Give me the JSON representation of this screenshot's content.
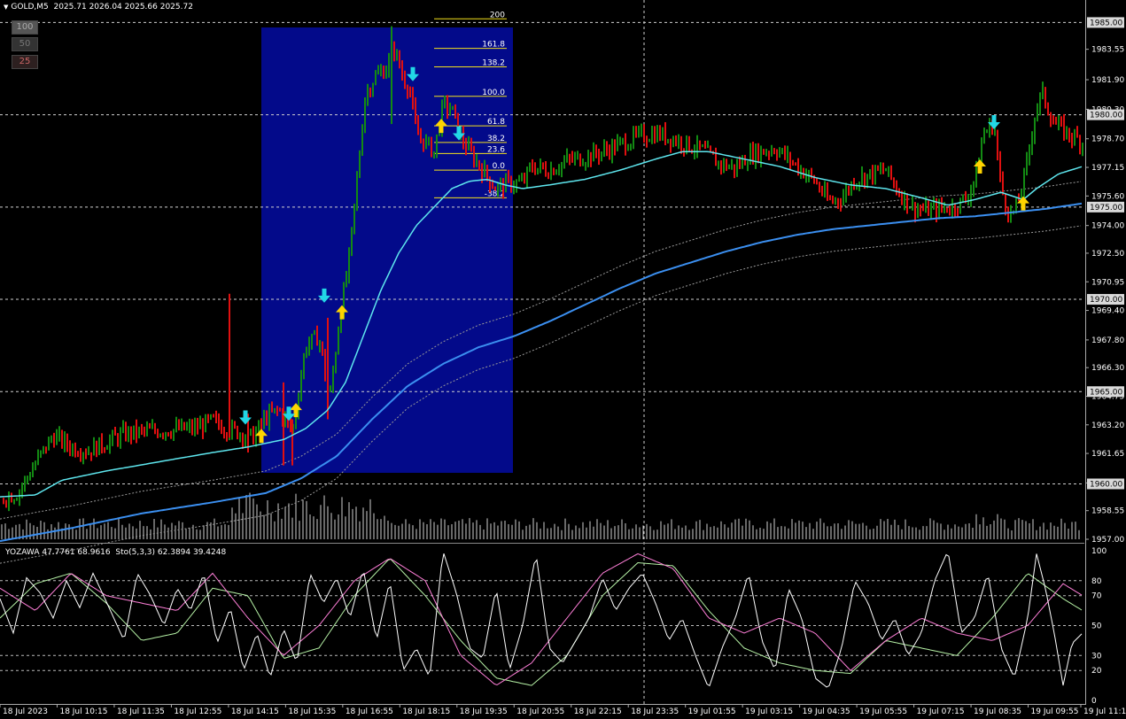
{
  "window": {
    "symbol_title": "GOLD,M5",
    "ohlc": "2025.71 2026.04 2025.66 2025.72"
  },
  "buttons": [
    {
      "label": "100"
    },
    {
      "label": "50"
    },
    {
      "label": "25"
    }
  ],
  "oscillator": {
    "title": "YOZAWA 47.7761 68.9616",
    "stoch_label": "Sto(5,3,3) 62.3894 39.4248"
  },
  "colors": {
    "background": "#000000",
    "up_bar": "#138a13",
    "down_bar": "#e01010",
    "fast_ma": "#5ee6ee",
    "slow_ma": "#3b8ff0",
    "fib_box": "#030a8a",
    "fib_line": "#f4e11c",
    "arrow_up": "#ffd400",
    "arrow_down": "#22d7e6",
    "stoch_main": "#ffffff",
    "stoch_signal": "#ff7fd8",
    "yozawa": "#b6f2a6"
  },
  "icons": {
    "buy": "arrow-up-icon",
    "sell": "arrow-down-icon"
  },
  "chart_data": {
    "type": "bar",
    "price_axis": {
      "ticks": [
        "1983.55",
        "1981.90",
        "1980.30",
        "1978.70",
        "1977.15",
        "1975.60",
        "1974.00",
        "1972.50",
        "1970.95",
        "1969.40",
        "1967.80",
        "1966.30",
        "1964.75",
        "1963.20",
        "1961.65",
        "1960.05",
        "1958.55",
        "1957.00"
      ],
      "ylim": [
        1957.0,
        1985.5
      ],
      "level_lines": [
        1985.0,
        1980.0,
        1975.0,
        1970.0,
        1965.0,
        1960.0
      ],
      "level_labels": [
        "1985.00",
        "1980.00",
        "1975.00",
        "1970.00",
        "1965.00",
        "1960.00"
      ]
    },
    "time_axis": {
      "labels": [
        "18 Jul 2023",
        "18 Jul 10:15",
        "18 Jul 11:35",
        "18 Jul 12:55",
        "18 Jul 14:15",
        "18 Jul 15:35",
        "18 Jul 16:55",
        "18 Jul 18:15",
        "18 Jul 19:35",
        "18 Jul 20:55",
        "18 Jul 22:15",
        "18 Jul 23:35",
        "19 Jul 01:55",
        "19 Jul 03:15",
        "19 Jul 04:35",
        "19 Jul 05:55",
        "19 Jul 07:15",
        "19 Jul 08:35",
        "19 Jul 09:55",
        "19 Jul 11:15"
      ]
    },
    "fibonacci": {
      "levels": [
        "200",
        "161.8",
        "138.2",
        "100.0",
        "61.8",
        "38.2",
        "23.6",
        "0.0",
        "-38.2"
      ],
      "prices": [
        1985.2,
        1983.6,
        1982.6,
        1981.0,
        1979.4,
        1978.5,
        1977.9,
        1977.0,
        1975.5
      ]
    },
    "oscillator_axis": {
      "ticks": [
        "100",
        "80",
        "70",
        "50",
        "30",
        "20",
        "0"
      ],
      "ylim": [
        0,
        100
      ]
    },
    "price_anchors": [
      [
        0,
        1959.2
      ],
      [
        20,
        1959.5
      ],
      [
        30,
        1960.3
      ],
      [
        45,
        1961.5
      ],
      [
        60,
        1962.6
      ],
      [
        80,
        1962.0
      ],
      [
        100,
        1961.8
      ],
      [
        140,
        1962.7
      ],
      [
        180,
        1962.9
      ],
      [
        220,
        1963.0
      ],
      [
        240,
        1963.4
      ],
      [
        255,
        1963.0
      ],
      [
        270,
        1962.8
      ],
      [
        285,
        1962.5
      ],
      [
        300,
        1963.6
      ],
      [
        315,
        1964.0
      ],
      [
        330,
        1962.8
      ],
      [
        345,
        1967.5
      ],
      [
        360,
        1968.0
      ],
      [
        372,
        1964.5
      ],
      [
        382,
        1968.5
      ],
      [
        395,
        1972.5
      ],
      [
        405,
        1977.5
      ],
      [
        412,
        1981.0
      ],
      [
        422,
        1982.0
      ],
      [
        435,
        1982.5
      ],
      [
        445,
        1983.6
      ],
      [
        455,
        1982.0
      ],
      [
        462,
        1981.5
      ],
      [
        470,
        1979.0
      ],
      [
        480,
        1978.5
      ],
      [
        490,
        1978.0
      ],
      [
        500,
        1980.5
      ],
      [
        510,
        1980.3
      ],
      [
        520,
        1978.8
      ],
      [
        530,
        1978.0
      ],
      [
        545,
        1977.0
      ],
      [
        560,
        1976.0
      ],
      [
        575,
        1976.3
      ],
      [
        590,
        1976.3
      ],
      [
        600,
        1977.2
      ],
      [
        620,
        1977.0
      ],
      [
        640,
        1977.5
      ],
      [
        660,
        1977.7
      ],
      [
        680,
        1978.0
      ],
      [
        700,
        1978.4
      ],
      [
        720,
        1978.8
      ],
      [
        740,
        1979.0
      ],
      [
        760,
        1978.7
      ],
      [
        780,
        1978.3
      ],
      [
        795,
        1978.0
      ],
      [
        810,
        1977.4
      ],
      [
        830,
        1977.1
      ],
      [
        845,
        1977.8
      ],
      [
        860,
        1978.0
      ],
      [
        875,
        1978.2
      ],
      [
        890,
        1977.6
      ],
      [
        905,
        1977.0
      ],
      [
        920,
        1976.4
      ],
      [
        935,
        1975.3
      ],
      [
        950,
        1975.5
      ],
      [
        965,
        1976.5
      ],
      [
        985,
        1976.8
      ],
      [
        1000,
        1977.0
      ],
      [
        1015,
        1975.8
      ],
      [
        1030,
        1975.0
      ],
      [
        1045,
        1974.8
      ],
      [
        1060,
        1974.9
      ],
      [
        1075,
        1975.0
      ],
      [
        1090,
        1975.4
      ],
      [
        1100,
        1976.5
      ],
      [
        1110,
        1979.0
      ],
      [
        1122,
        1979.5
      ],
      [
        1130,
        1976.0
      ],
      [
        1140,
        1974.5
      ],
      [
        1148,
        1975.0
      ],
      [
        1158,
        1977.0
      ],
      [
        1168,
        1980.0
      ],
      [
        1176,
        1981.2
      ],
      [
        1190,
        1979.5
      ],
      [
        1205,
        1979.0
      ],
      [
        1222,
        1978.5
      ]
    ],
    "fast_ma_anchors": [
      [
        0,
        1959.3
      ],
      [
        40,
        1959.4
      ],
      [
        70,
        1960.2
      ],
      [
        120,
        1960.7
      ],
      [
        180,
        1961.2
      ],
      [
        240,
        1961.7
      ],
      [
        280,
        1962.0
      ],
      [
        320,
        1962.4
      ],
      [
        345,
        1963.0
      ],
      [
        370,
        1964.0
      ],
      [
        390,
        1965.5
      ],
      [
        410,
        1968.0
      ],
      [
        430,
        1970.5
      ],
      [
        450,
        1972.5
      ],
      [
        470,
        1974.0
      ],
      [
        490,
        1975.0
      ],
      [
        510,
        1976.0
      ],
      [
        530,
        1976.4
      ],
      [
        550,
        1976.5
      ],
      [
        570,
        1976.2
      ],
      [
        590,
        1976.0
      ],
      [
        620,
        1976.2
      ],
      [
        660,
        1976.5
      ],
      [
        700,
        1977.0
      ],
      [
        740,
        1977.6
      ],
      [
        770,
        1978.0
      ],
      [
        800,
        1978.0
      ],
      [
        840,
        1977.6
      ],
      [
        880,
        1977.2
      ],
      [
        920,
        1976.6
      ],
      [
        960,
        1976.2
      ],
      [
        1000,
        1976.0
      ],
      [
        1040,
        1975.5
      ],
      [
        1070,
        1975.1
      ],
      [
        1100,
        1975.4
      ],
      [
        1130,
        1975.8
      ],
      [
        1155,
        1975.4
      ],
      [
        1170,
        1976.0
      ],
      [
        1195,
        1976.8
      ],
      [
        1222,
        1977.2
      ]
    ],
    "slow_ma_anchors": [
      [
        0,
        1956.9
      ],
      [
        80,
        1957.6
      ],
      [
        160,
        1958.4
      ],
      [
        240,
        1959.0
      ],
      [
        300,
        1959.5
      ],
      [
        340,
        1960.3
      ],
      [
        380,
        1961.5
      ],
      [
        420,
        1963.5
      ],
      [
        460,
        1965.3
      ],
      [
        500,
        1966.5
      ],
      [
        540,
        1967.4
      ],
      [
        580,
        1968.0
      ],
      [
        620,
        1968.8
      ],
      [
        660,
        1969.7
      ],
      [
        700,
        1970.6
      ],
      [
        740,
        1971.4
      ],
      [
        780,
        1972.0
      ],
      [
        820,
        1972.6
      ],
      [
        860,
        1973.1
      ],
      [
        900,
        1973.5
      ],
      [
        940,
        1973.8
      ],
      [
        980,
        1974.0
      ],
      [
        1020,
        1974.2
      ],
      [
        1060,
        1974.4
      ],
      [
        1100,
        1974.5
      ],
      [
        1140,
        1974.7
      ],
      [
        1180,
        1974.9
      ],
      [
        1222,
        1975.2
      ]
    ],
    "arrows_up": [
      [
        295,
        1962.6
      ],
      [
        334,
        1964.0
      ],
      [
        386,
        1969.3
      ],
      [
        498,
        1979.4
      ],
      [
        1106,
        1977.2
      ],
      [
        1155,
        1975.2
      ]
    ],
    "arrows_down": [
      [
        277,
        1963.6
      ],
      [
        326,
        1963.8
      ],
      [
        366,
        1970.2
      ],
      [
        466,
        1982.2
      ],
      [
        518,
        1979.0
      ],
      [
        1122,
        1979.6
      ]
    ],
    "stoch_main_anchors": [
      [
        0,
        68
      ],
      [
        15,
        45
      ],
      [
        30,
        82
      ],
      [
        45,
        72
      ],
      [
        60,
        55
      ],
      [
        75,
        80
      ],
      [
        90,
        62
      ],
      [
        105,
        85
      ],
      [
        120,
        66
      ],
      [
        140,
        40
      ],
      [
        155,
        85
      ],
      [
        170,
        70
      ],
      [
        185,
        50
      ],
      [
        200,
        75
      ],
      [
        215,
        60
      ],
      [
        230,
        85
      ],
      [
        245,
        38
      ],
      [
        260,
        62
      ],
      [
        275,
        20
      ],
      [
        290,
        45
      ],
      [
        305,
        15
      ],
      [
        320,
        48
      ],
      [
        335,
        25
      ],
      [
        350,
        85
      ],
      [
        365,
        65
      ],
      [
        380,
        82
      ],
      [
        395,
        55
      ],
      [
        410,
        88
      ],
      [
        425,
        40
      ],
      [
        440,
        80
      ],
      [
        455,
        20
      ],
      [
        470,
        35
      ],
      [
        485,
        15
      ],
      [
        500,
        100
      ],
      [
        515,
        72
      ],
      [
        530,
        35
      ],
      [
        545,
        28
      ],
      [
        560,
        75
      ],
      [
        575,
        20
      ],
      [
        590,
        50
      ],
      [
        605,
        98
      ],
      [
        620,
        35
      ],
      [
        635,
        25
      ],
      [
        650,
        40
      ],
      [
        665,
        55
      ],
      [
        680,
        82
      ],
      [
        695,
        60
      ],
      [
        710,
        75
      ],
      [
        725,
        85
      ],
      [
        740,
        65
      ],
      [
        755,
        40
      ],
      [
        770,
        55
      ],
      [
        785,
        30
      ],
      [
        800,
        8
      ],
      [
        815,
        35
      ],
      [
        830,
        55
      ],
      [
        845,
        85
      ],
      [
        860,
        40
      ],
      [
        875,
        20
      ],
      [
        890,
        75
      ],
      [
        905,
        55
      ],
      [
        920,
        15
      ],
      [
        935,
        8
      ],
      [
        950,
        35
      ],
      [
        965,
        80
      ],
      [
        980,
        65
      ],
      [
        995,
        40
      ],
      [
        1010,
        55
      ],
      [
        1025,
        30
      ],
      [
        1040,
        45
      ],
      [
        1055,
        80
      ],
      [
        1070,
        100
      ],
      [
        1085,
        45
      ],
      [
        1100,
        55
      ],
      [
        1115,
        85
      ],
      [
        1130,
        35
      ],
      [
        1145,
        15
      ],
      [
        1160,
        55
      ],
      [
        1170,
        98
      ],
      [
        1180,
        75
      ],
      [
        1190,
        45
      ],
      [
        1200,
        10
      ],
      [
        1210,
        38
      ],
      [
        1222,
        45
      ]
    ],
    "stoch_signal_anchors": [
      [
        0,
        75
      ],
      [
        40,
        60
      ],
      [
        80,
        85
      ],
      [
        120,
        70
      ],
      [
        160,
        65
      ],
      [
        200,
        60
      ],
      [
        240,
        85
      ],
      [
        280,
        55
      ],
      [
        320,
        30
      ],
      [
        360,
        50
      ],
      [
        400,
        80
      ],
      [
        440,
        95
      ],
      [
        480,
        80
      ],
      [
        520,
        30
      ],
      [
        560,
        10
      ],
      [
        600,
        25
      ],
      [
        640,
        55
      ],
      [
        680,
        85
      ],
      [
        720,
        98
      ],
      [
        760,
        88
      ],
      [
        800,
        55
      ],
      [
        840,
        45
      ],
      [
        880,
        55
      ],
      [
        920,
        45
      ],
      [
        960,
        20
      ],
      [
        1000,
        40
      ],
      [
        1040,
        55
      ],
      [
        1080,
        45
      ],
      [
        1120,
        40
      ],
      [
        1160,
        50
      ],
      [
        1200,
        78
      ],
      [
        1222,
        70
      ]
    ],
    "yozawa_anchors": [
      [
        0,
        55
      ],
      [
        40,
        78
      ],
      [
        80,
        85
      ],
      [
        120,
        65
      ],
      [
        160,
        40
      ],
      [
        200,
        45
      ],
      [
        240,
        75
      ],
      [
        280,
        70
      ],
      [
        320,
        28
      ],
      [
        360,
        35
      ],
      [
        400,
        70
      ],
      [
        440,
        95
      ],
      [
        480,
        70
      ],
      [
        520,
        40
      ],
      [
        560,
        15
      ],
      [
        600,
        10
      ],
      [
        640,
        30
      ],
      [
        680,
        70
      ],
      [
        720,
        92
      ],
      [
        760,
        90
      ],
      [
        800,
        60
      ],
      [
        840,
        35
      ],
      [
        880,
        25
      ],
      [
        920,
        20
      ],
      [
        960,
        18
      ],
      [
        1000,
        40
      ],
      [
        1040,
        35
      ],
      [
        1080,
        30
      ],
      [
        1120,
        55
      ],
      [
        1160,
        85
      ],
      [
        1200,
        68
      ],
      [
        1222,
        60
      ]
    ]
  }
}
